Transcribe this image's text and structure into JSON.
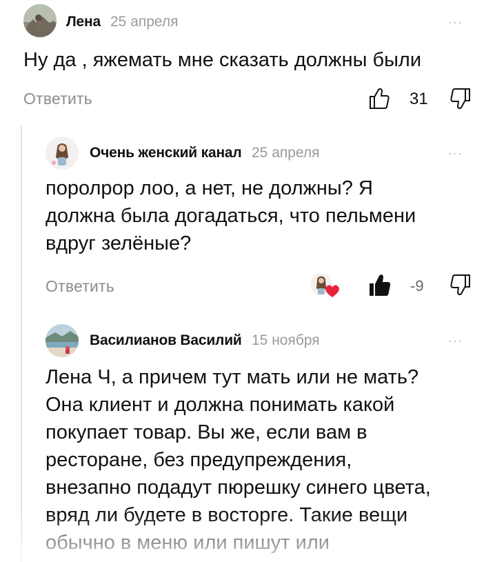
{
  "comments": [
    {
      "author": "Лена",
      "date": "25 апреля",
      "more": "···",
      "text": "Ну да , яжемать мне сказать должны были",
      "reply_label": "Ответить",
      "like_count": "31"
    },
    {
      "author": "Очень женский канал",
      "date": "25 апреля",
      "more": "···",
      "text_lines": [
        "поролрор лоо, а нет, не должны? Я",
        "должна была догадаться, что пельмени",
        "вдруг зелёные?"
      ],
      "reply_label": "Ответить",
      "like_count": "-9"
    },
    {
      "author": "Василианов Василий",
      "date": "15 ноября",
      "more": "···",
      "text_lines": [
        "Лена Ч, а причем тут мать или не мать?",
        "Она клиент и должна понимать какой",
        "покупает товар. Вы же, если вам в",
        "ресторане, без предупреждения,",
        "внезапно подадут пюрешку синего цвета,",
        "вряд ли будете в восторге.  Такие вещи",
        "обычно в меню или пишут или"
      ]
    }
  ],
  "icons": {
    "like": "thumbs-up-icon",
    "dislike": "thumbs-down-icon",
    "author_liked": "author-heart-icon"
  },
  "colors": {
    "reply": "#8c8c8c",
    "date": "#9a9a9a",
    "heart": "#e8223d",
    "thread_line": "#e2e2e2"
  }
}
